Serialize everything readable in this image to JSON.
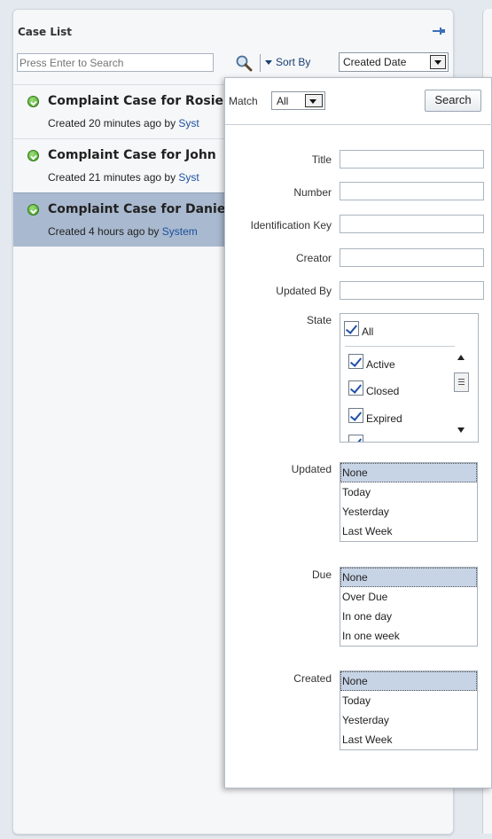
{
  "case_list": {
    "title": "Case List",
    "search_placeholder": "Press Enter to Search",
    "sort_by_label": "Sort By",
    "sort_by_value": "Created Date",
    "cases": [
      {
        "title": "Complaint Case for Rosie",
        "meta_prefix": "Created 20 minutes ago by ",
        "meta_by": "Syst",
        "selected": false
      },
      {
        "title": "Complaint Case for John",
        "meta_prefix": "Created 21 minutes ago by ",
        "meta_by": "Syst",
        "selected": false
      },
      {
        "title": "Complaint Case for Danie",
        "meta_prefix": "Created 4 hours ago by ",
        "meta_by": "System",
        "selected": true
      }
    ]
  },
  "search_popup": {
    "match_label": "Match",
    "match_value": "All",
    "search_button": "Search",
    "fields": {
      "title": "Title",
      "number": "Number",
      "identification_key": "Identification Key",
      "creator": "Creator",
      "updated_by": "Updated By",
      "state": "State"
    },
    "state_options": {
      "all": "All",
      "active": "Active",
      "closed": "Closed",
      "expired": "Expired"
    },
    "updated": {
      "label": "Updated",
      "options": [
        "None",
        "Today",
        "Yesterday",
        "Last Week"
      ],
      "selected": "None"
    },
    "due": {
      "label": "Due",
      "options": [
        "None",
        "Over Due",
        "In one day",
        "In one week"
      ],
      "selected": "None"
    },
    "created": {
      "label": "Created",
      "options": [
        "None",
        "Today",
        "Yesterday",
        "Last Week"
      ],
      "selected": "None"
    }
  },
  "colors": {
    "selected_row": "#a9b9cf",
    "link_blue": "#1c4f9c",
    "status_green": "#3f9a24"
  }
}
